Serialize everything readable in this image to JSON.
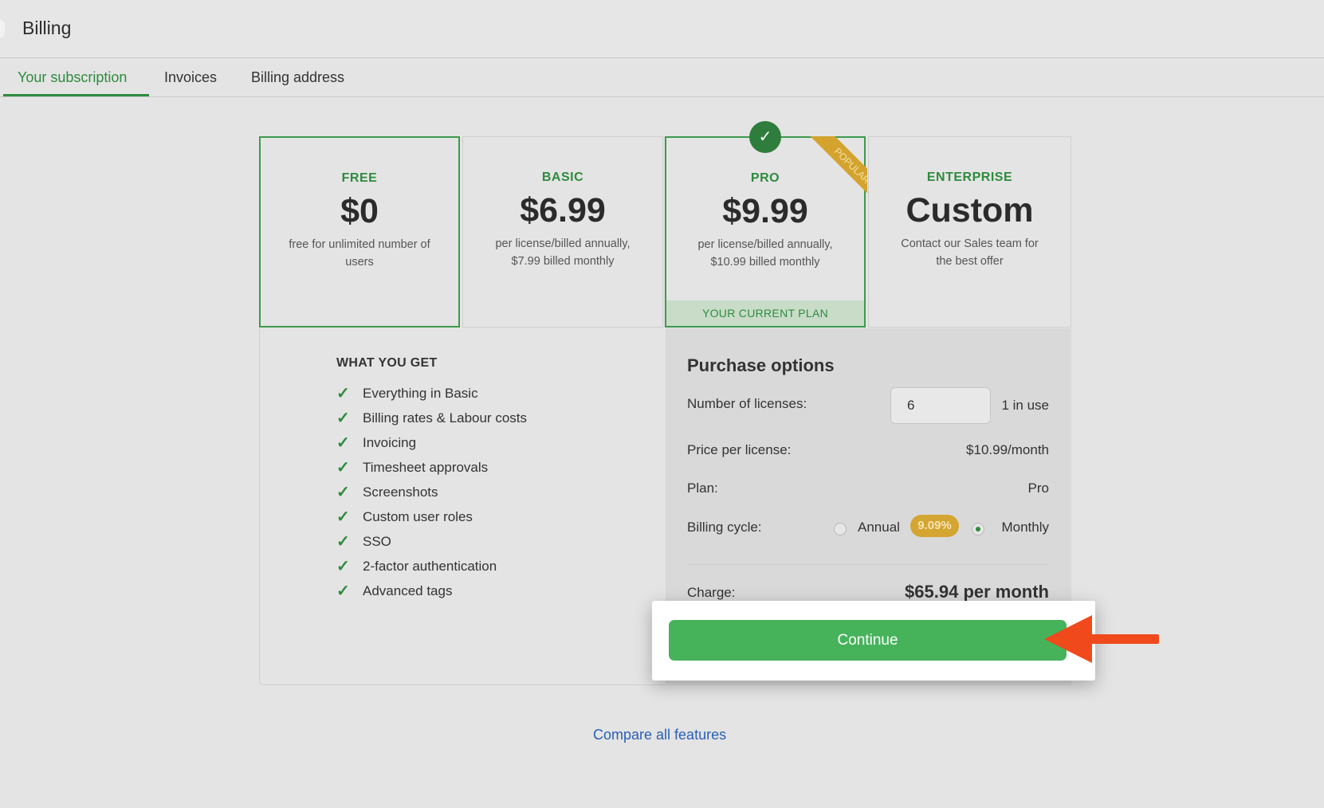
{
  "header": {
    "title": "Billing"
  },
  "tabs": [
    {
      "label": "Your subscription",
      "active": true
    },
    {
      "label": "Invoices",
      "active": false
    },
    {
      "label": "Billing address",
      "active": false
    }
  ],
  "plans": [
    {
      "name": "FREE",
      "price": "$0",
      "desc": "free for unlimited number of users"
    },
    {
      "name": "BASIC",
      "price": "$6.99",
      "desc": "per license/billed annually, $7.99 billed monthly"
    },
    {
      "name": "PRO",
      "price": "$9.99",
      "desc": "per license/billed annually, $10.99 billed monthly",
      "badge": "POPULAR",
      "current_label": "YOUR CURRENT PLAN"
    },
    {
      "name": "ENTERPRISE",
      "price": "Custom",
      "desc": "Contact our Sales team for the best offer"
    }
  ],
  "what_you_get": {
    "title": "WHAT YOU GET",
    "items": [
      "Everything in Basic",
      "Billing rates & Labour costs",
      "Invoicing",
      "Timesheet approvals",
      "Screenshots",
      "Custom user roles",
      "SSO",
      "2-factor authentication",
      "Advanced tags"
    ]
  },
  "purchase": {
    "title": "Purchase options",
    "licenses_label": "Number of licenses:",
    "licenses_value": "6",
    "in_use": "1 in use",
    "price_label": "Price per license:",
    "price_value": "$10.99/month",
    "plan_label": "Plan:",
    "plan_value": "Pro",
    "cycle_label": "Billing cycle:",
    "annual_label": "Annual",
    "discount": "9.09%",
    "monthly_label": "Monthly",
    "selected_cycle": "Monthly",
    "charge_label": "Charge:",
    "charge_value": "$65.94 per month"
  },
  "continue_label": "Continue",
  "compare_link": "Compare all features",
  "colors": {
    "accent": "#2e8b3e",
    "button": "#46b35b",
    "arrow": "#f04a1c",
    "badge": "#d3a32d",
    "link": "#2a5fb8"
  }
}
